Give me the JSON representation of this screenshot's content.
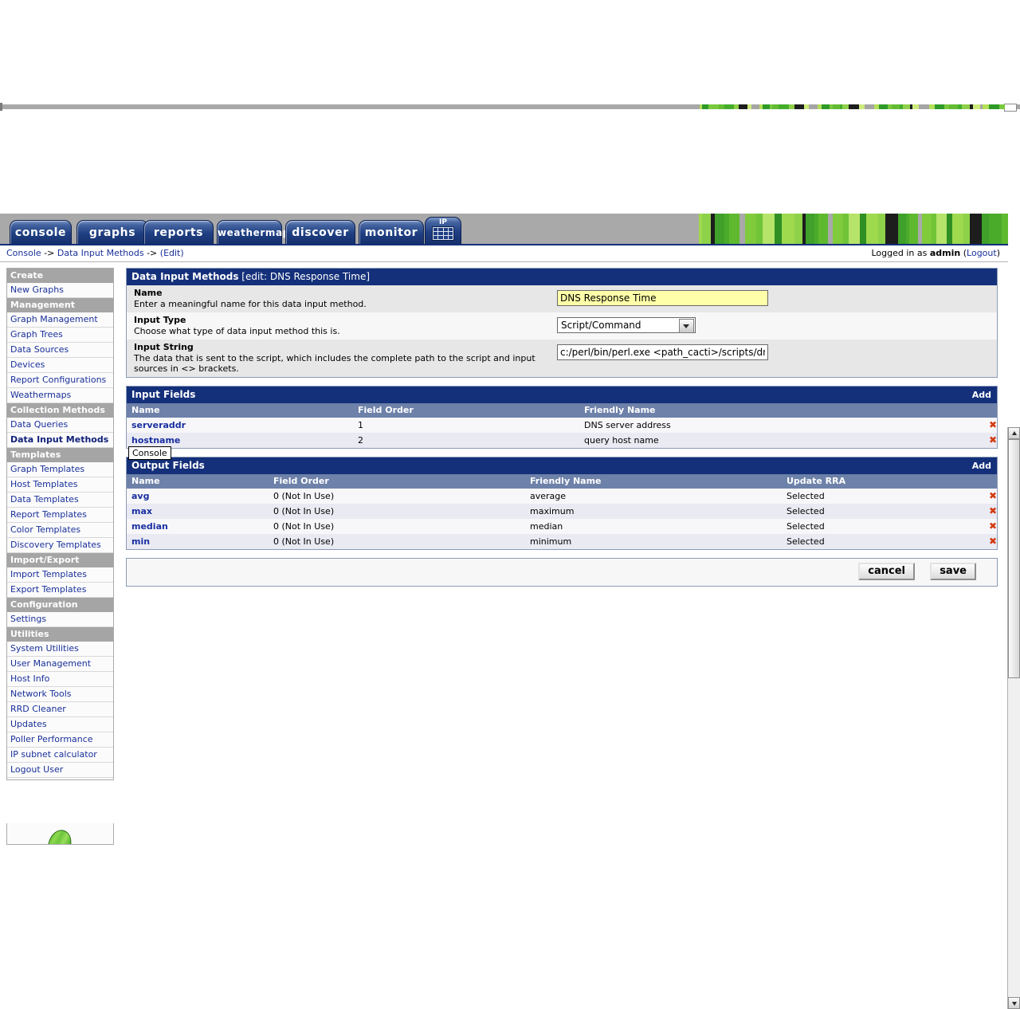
{
  "tabs": [
    {
      "label": "console",
      "name": "tab-console"
    },
    {
      "label": "graphs",
      "name": "tab-graphs"
    },
    {
      "label": "reports",
      "name": "tab-reports"
    },
    {
      "label": "weathermap",
      "name": "tab-weathermap"
    },
    {
      "label": "discover",
      "name": "tab-discover"
    },
    {
      "label": "monitor",
      "name": "tab-monitor"
    }
  ],
  "ip_tab": {
    "label": "IP",
    "icon": "calculator-icon"
  },
  "tooltip": {
    "text": "Console"
  },
  "breadcrumb": {
    "console": "Console",
    "sep1": " -> ",
    "section": "Data Input Methods",
    "sep2": " -> ",
    "current": "(Edit)"
  },
  "login": {
    "prefix": "Logged in as ",
    "user": "admin",
    "open_paren": " (",
    "logout": "Logout",
    "close_paren": ")"
  },
  "sidebar": {
    "groups": [
      {
        "header": "Create",
        "items": [
          {
            "label": "New Graphs",
            "active": false
          }
        ]
      },
      {
        "header": "Management",
        "items": [
          {
            "label": "Graph Management",
            "active": false
          },
          {
            "label": "Graph Trees",
            "active": false
          },
          {
            "label": "Data Sources",
            "active": false
          },
          {
            "label": "Devices",
            "active": false
          },
          {
            "label": "Report Configurations",
            "active": false
          },
          {
            "label": "Weathermaps",
            "active": false
          }
        ]
      },
      {
        "header": "Collection Methods",
        "items": [
          {
            "label": "Data Queries",
            "active": false
          },
          {
            "label": "Data Input Methods",
            "active": true
          }
        ]
      },
      {
        "header": "Templates",
        "items": [
          {
            "label": "Graph Templates",
            "active": false
          },
          {
            "label": "Host Templates",
            "active": false
          },
          {
            "label": "Data Templates",
            "active": false
          },
          {
            "label": "Report Templates",
            "active": false
          },
          {
            "label": "Color Templates",
            "active": false
          },
          {
            "label": "Discovery Templates",
            "active": false
          }
        ]
      },
      {
        "header": "Import/Export",
        "items": [
          {
            "label": "Import Templates",
            "active": false
          },
          {
            "label": "Export Templates",
            "active": false
          }
        ]
      },
      {
        "header": "Configuration",
        "items": [
          {
            "label": "Settings",
            "active": false
          }
        ]
      },
      {
        "header": "Utilities",
        "items": [
          {
            "label": "System Utilities",
            "active": false
          },
          {
            "label": "User Management",
            "active": false
          },
          {
            "label": "Host Info",
            "active": false
          },
          {
            "label": "Network Tools",
            "active": false
          },
          {
            "label": "RRD Cleaner",
            "active": false
          },
          {
            "label": "Updates",
            "active": false
          },
          {
            "label": "Poller Performance",
            "active": false
          },
          {
            "label": "IP subnet calculator",
            "active": false
          },
          {
            "label": "Logout User",
            "active": false
          }
        ]
      }
    ]
  },
  "edit_panel": {
    "title": "Data Input Methods",
    "subtitle": " [edit: DNS Response Time]",
    "fields": [
      {
        "label": "Name",
        "description": "Enter a meaningful name for this data input method.",
        "value": "DNS Response Time",
        "control": "text"
      },
      {
        "label": "Input Type",
        "description": "Choose what type of data input method this is.",
        "value": "Script/Command",
        "control": "select"
      },
      {
        "label": "Input String",
        "description": "The data that is sent to the script, which includes the complete path to the script and input sources in <> brackets.",
        "value": "c:/perl/bin/perl.exe <path_cacti>/scripts/dnsr",
        "control": "text"
      }
    ]
  },
  "input_fields_panel": {
    "title": "Input Fields",
    "add_label": "Add",
    "columns": [
      "Name",
      "Field Order",
      "Friendly Name"
    ],
    "rows": [
      {
        "name": "serveraddr",
        "field_order": "1",
        "friendly_name": "DNS server address"
      },
      {
        "name": "hostname",
        "field_order": "2",
        "friendly_name": "query host name"
      }
    ]
  },
  "output_fields_panel": {
    "title": "Output Fields",
    "add_label": "Add",
    "columns": [
      "Name",
      "Field Order",
      "Friendly Name",
      "Update RRA"
    ],
    "rows": [
      {
        "name": "avg",
        "field_order": "0 (Not In Use)",
        "friendly_name": "average",
        "update_rra": "Selected"
      },
      {
        "name": "max",
        "field_order": "0 (Not In Use)",
        "friendly_name": "maximum",
        "update_rra": "Selected"
      },
      {
        "name": "median",
        "field_order": "0 (Not In Use)",
        "friendly_name": "median",
        "update_rra": "Selected"
      },
      {
        "name": "min",
        "field_order": "0 (Not In Use)",
        "friendly_name": "minimum",
        "update_rra": "Selected"
      }
    ]
  },
  "actions": {
    "cancel_label": "cancel",
    "save_label": "save"
  },
  "icons": {
    "delete": "✖"
  },
  "colors": {
    "panel_header": "#14307a",
    "table_header": "#6d81a9",
    "link": "#19309a",
    "delete_icon": "#d43a12",
    "highlight_field": "#ffffa9",
    "menu_header": "#a5a5a5"
  }
}
